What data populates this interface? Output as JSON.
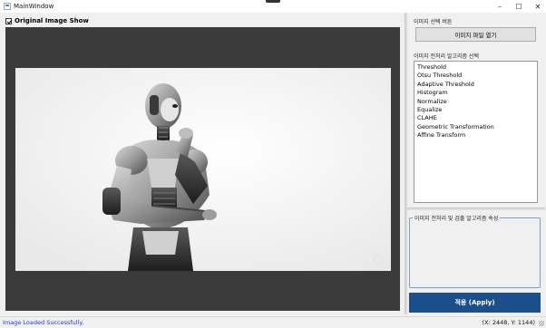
{
  "window": {
    "title": "MainWindow",
    "icon": "window-app-icon",
    "controls": {
      "minimize": "–",
      "maximize": "☐",
      "close": "✕"
    }
  },
  "left_pane": {
    "show_checkbox": {
      "label": "Original Image Show",
      "checked": true
    },
    "image": {
      "subject": "robot-photo"
    }
  },
  "right_pane": {
    "file_section_label": "이미지 선택 버튼",
    "open_button_label": "이미지 파일 열기",
    "algo_section_label": "이미지 전처리 알고리즘 선택",
    "algorithms": [
      "Threshold",
      "Otsu Threshold",
      "Adaptive Threshold",
      "Histogram",
      "Normalize",
      "Equalize",
      "CLAHE",
      "Geometric Transformation",
      "Affine Transform"
    ],
    "properties_group_title": "이미지 전처리 및 검출 알고리즘 속성",
    "apply_button_label": "적용 (Apply)"
  },
  "status_bar": {
    "message": "Image Loaded Successfully.",
    "coordinates": "(X: 2448, Y: 1144)"
  },
  "colors": {
    "accent": "#1b4f8c",
    "status_text": "#1f3fd8",
    "viewer_bg": "#3b3b3b"
  }
}
